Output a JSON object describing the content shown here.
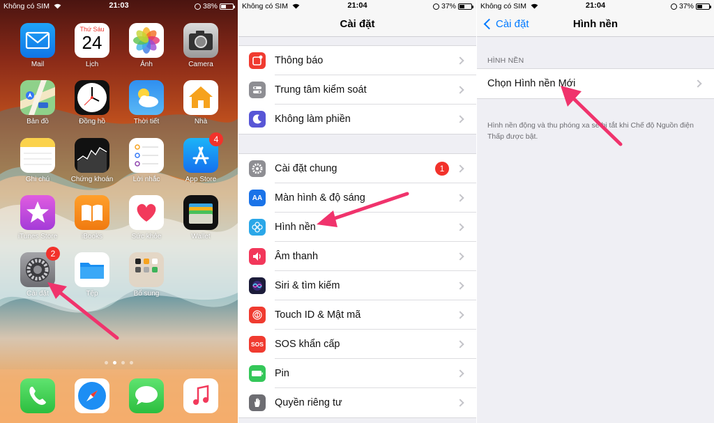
{
  "panel1": {
    "status": {
      "carrier": "Không có SIM",
      "time": "21:03",
      "battery": "38%"
    },
    "apps": [
      {
        "label": "Mail",
        "icon": "mail-icon"
      },
      {
        "label": "Lịch",
        "icon": "calendar-icon",
        "weekday": "Thứ Sáu",
        "day": "24"
      },
      {
        "label": "Ảnh",
        "icon": "photos-icon"
      },
      {
        "label": "Camera",
        "icon": "camera-icon"
      },
      {
        "label": "Bản đồ",
        "icon": "maps-icon"
      },
      {
        "label": "Đồng hồ",
        "icon": "clock-icon"
      },
      {
        "label": "Thời tiết",
        "icon": "weather-icon"
      },
      {
        "label": "Nhà",
        "icon": "home-icon"
      },
      {
        "label": "Ghi chú",
        "icon": "notes-icon"
      },
      {
        "label": "Chứng khoán",
        "icon": "stocks-icon"
      },
      {
        "label": "Lời nhắc",
        "icon": "reminders-icon"
      },
      {
        "label": "App Store",
        "icon": "app-store-icon",
        "badge": "4"
      },
      {
        "label": "iTunes Store",
        "icon": "itunes-star-icon"
      },
      {
        "label": "iBooks",
        "icon": "ibooks-icon"
      },
      {
        "label": "Sức khỏe",
        "icon": "health-heart-icon"
      },
      {
        "label": "Wallet",
        "icon": "wallet-icon"
      },
      {
        "label": "Cài đặt",
        "icon": "settings-gear-icon",
        "badge": "2"
      },
      {
        "label": "Tệp",
        "icon": "files-folder-icon"
      },
      {
        "label": "Bổ sung",
        "icon": "extras-folder-icon"
      }
    ],
    "dock": [
      {
        "icon": "phone-icon"
      },
      {
        "icon": "safari-compass-icon"
      },
      {
        "icon": "messages-icon"
      },
      {
        "icon": "music-note-icon"
      }
    ],
    "page_dots": 4,
    "active_dot": 1
  },
  "panel2": {
    "status": {
      "carrier": "Không có SIM",
      "time": "21:04",
      "battery": "37%"
    },
    "title": "Cài đặt",
    "group1": [
      {
        "label": "Thông báo",
        "icon": "notifications-icon",
        "color": "#f03b30"
      },
      {
        "label": "Trung tâm kiểm soát",
        "icon": "control-center-icon",
        "color": "#8e8e93"
      },
      {
        "label": "Không làm phiền",
        "icon": "moon-icon",
        "color": "#5856d6"
      }
    ],
    "group2": [
      {
        "label": "Cài đặt chung",
        "icon": "gear-icon",
        "color": "#8e8e93",
        "badge": "1"
      },
      {
        "label": "Màn hình & độ sáng",
        "icon": "display-aa-icon",
        "color": "#1a73e8"
      },
      {
        "label": "Hình nền",
        "icon": "wallpaper-flower-icon",
        "color": "#2aa7e8"
      },
      {
        "label": "Âm thanh",
        "icon": "speaker-icon",
        "color": "#f2375a"
      },
      {
        "label": "Siri & tìm kiếm",
        "icon": "siri-icon",
        "color": "#1c1c3a"
      },
      {
        "label": "Touch ID & Mật mã",
        "icon": "fingerprint-icon",
        "color": "#f03b30"
      },
      {
        "label": "SOS khẩn cấp",
        "icon": "sos-icon",
        "color": "#f03b30",
        "text": "SOS"
      },
      {
        "label": "Pin",
        "icon": "battery-icon",
        "color": "#34c759"
      },
      {
        "label": "Quyền riêng tư",
        "icon": "hand-icon",
        "color": "#6d6d72"
      }
    ]
  },
  "panel3": {
    "status": {
      "carrier": "Không có SIM",
      "time": "21:04",
      "battery": "37%"
    },
    "back_label": "Cài đặt",
    "title": "Hình nền",
    "section_header": "HÌNH NỀN",
    "choose_label": "Chọn Hình nền Mới",
    "footnote": "Hình nền động và thu phóng xa sẽ bị tắt khi Chế độ Nguồn điện Thấp được bật."
  },
  "colors": {
    "accent": "#007aff",
    "arrow": "#f0336c",
    "badge": "#f2322b"
  }
}
